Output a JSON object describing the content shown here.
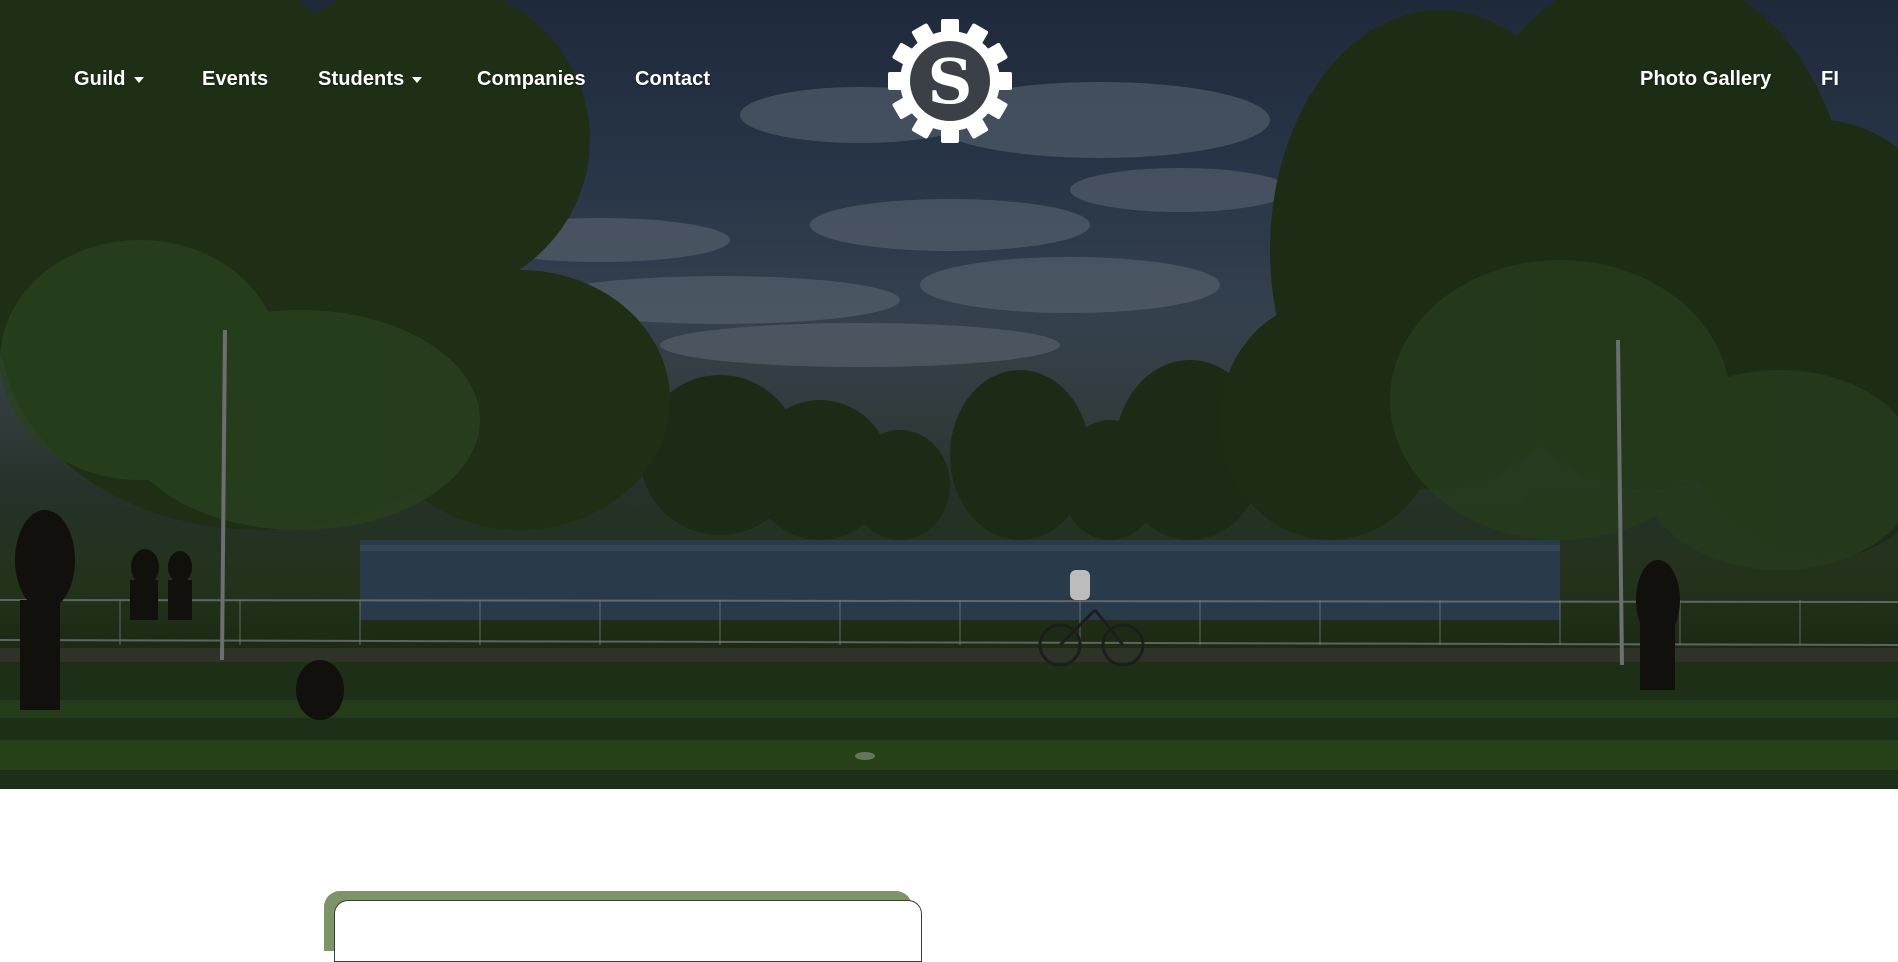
{
  "nav": {
    "left_items": [
      {
        "label": "Guild",
        "has_dropdown": true
      },
      {
        "label": "Events",
        "has_dropdown": false
      },
      {
        "label": "Students",
        "has_dropdown": true
      },
      {
        "label": "Companies",
        "has_dropdown": false
      },
      {
        "label": "Contact",
        "has_dropdown": false
      }
    ],
    "right_items": [
      {
        "label": "Photo Gallery"
      },
      {
        "label": "FI"
      }
    ],
    "logo": {
      "icon": "gear-s-logo-icon",
      "letter": "S"
    }
  },
  "hero": {
    "image": "park-lake-scene"
  },
  "colors": {
    "nav_text": "#ffffff",
    "card_accent": "#7c9466",
    "card_border": "#3a3a3a"
  }
}
